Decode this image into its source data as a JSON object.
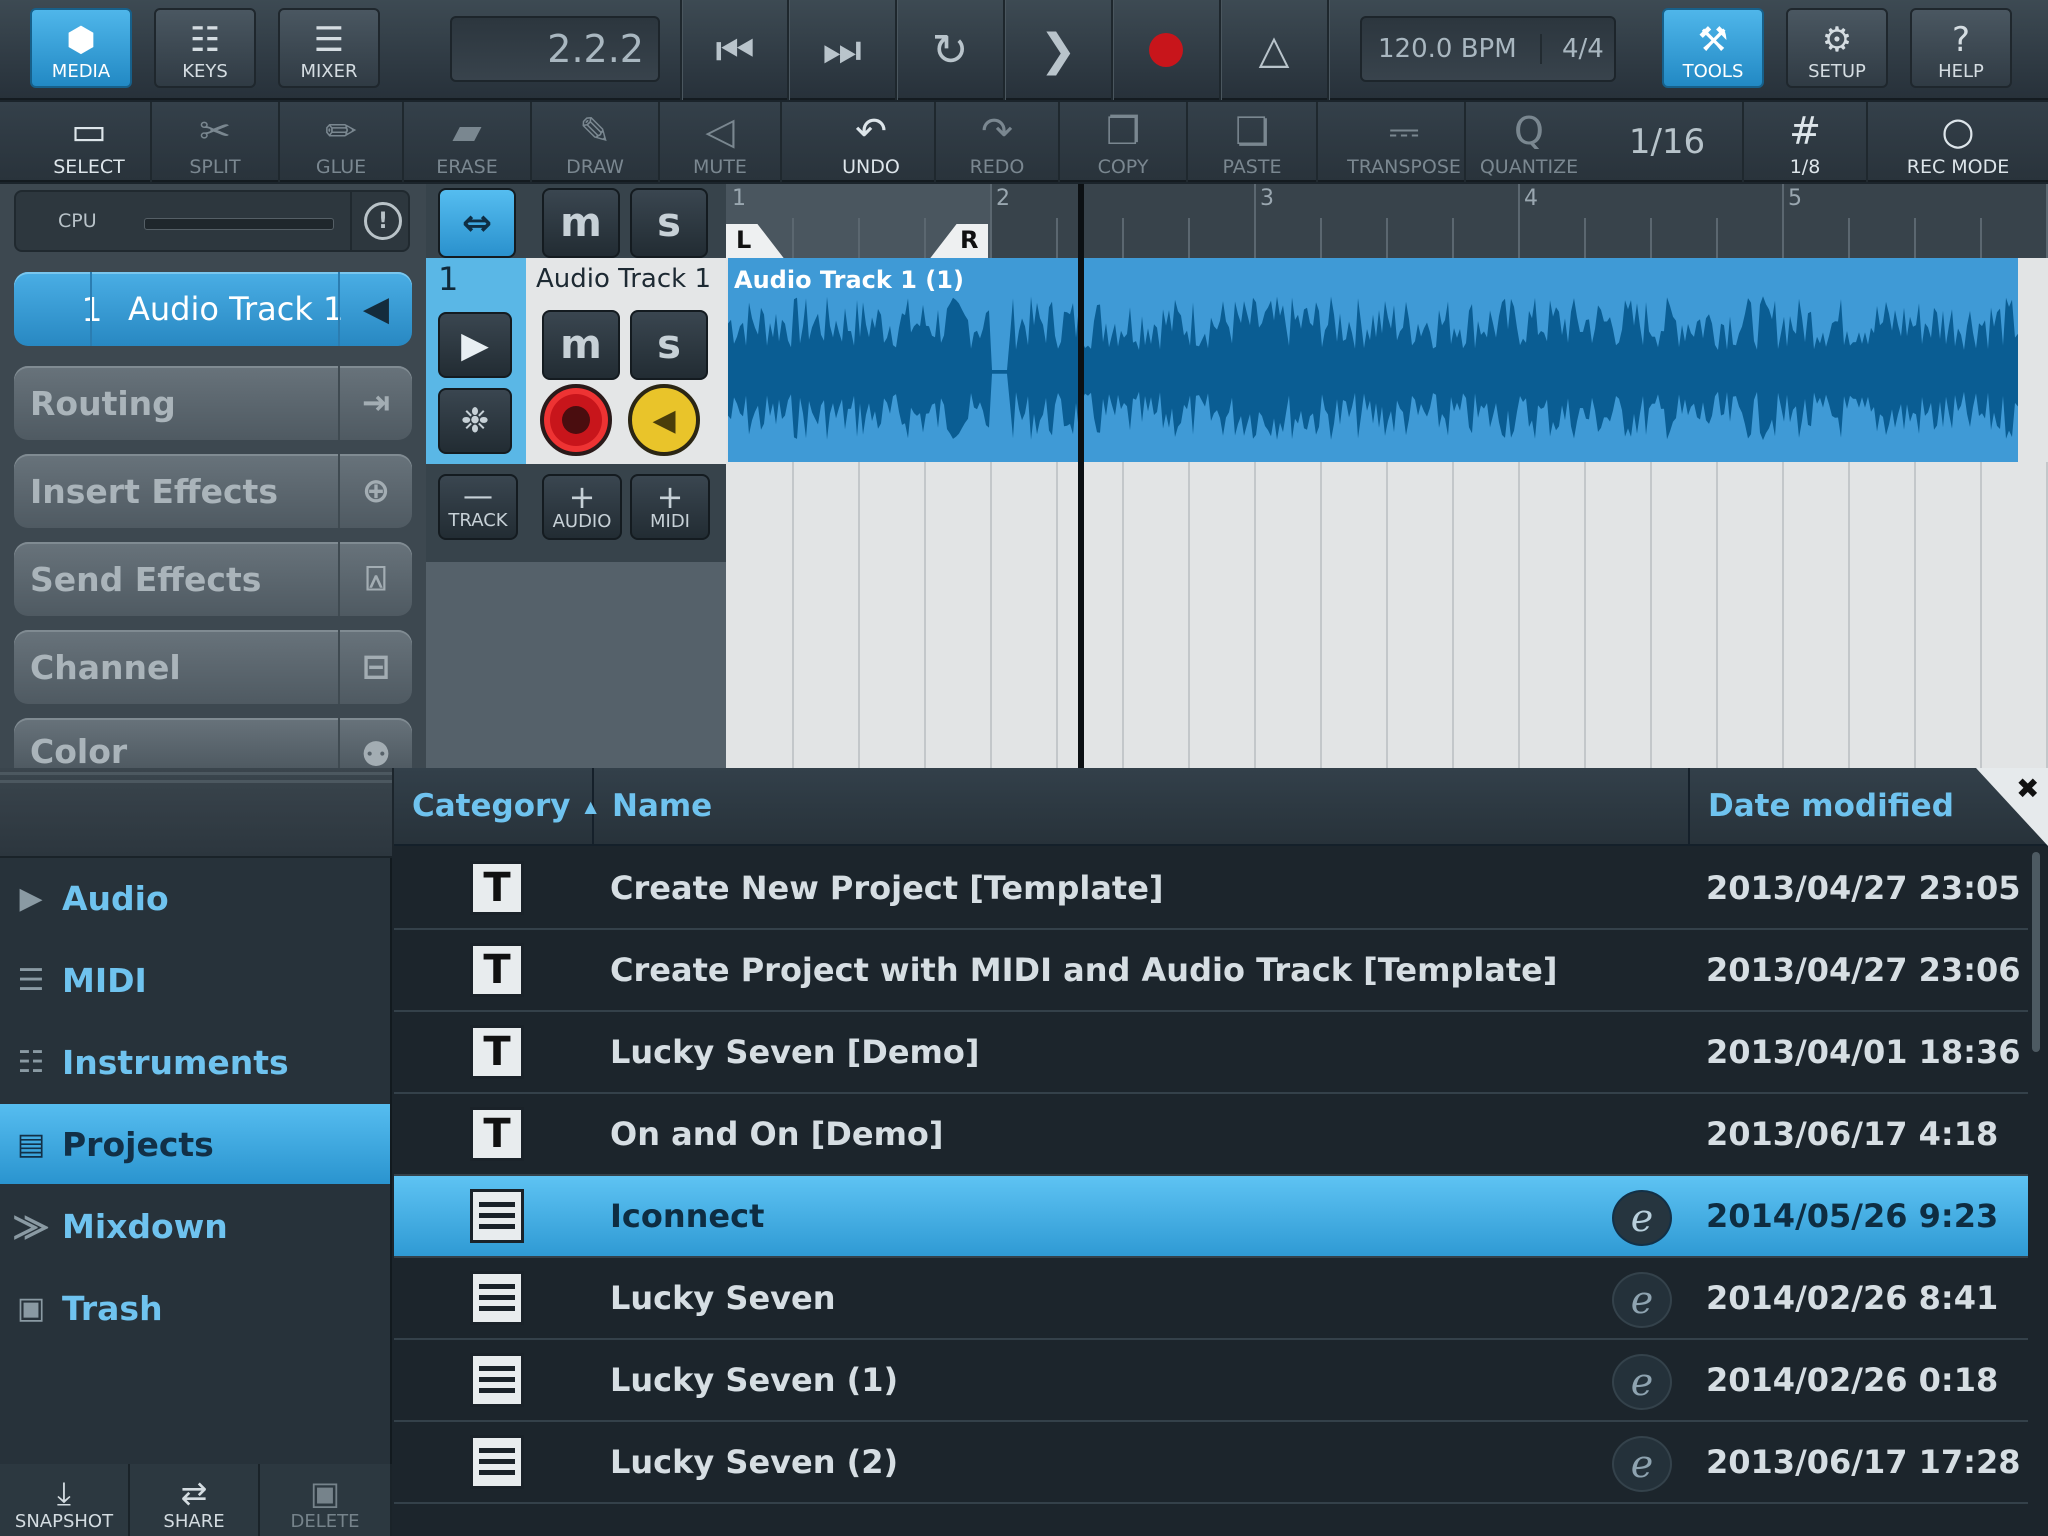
{
  "topbar": {
    "media": {
      "label": "MEDIA",
      "icon": "cube-icon"
    },
    "keys": {
      "label": "KEYS",
      "icon": "keys-icon"
    },
    "mixer": {
      "label": "MIXER",
      "icon": "mixer-icon"
    },
    "position": "2.2.2",
    "transport": [
      "skip-to-start-icon",
      "skip-to-end-icon",
      "loop-icon",
      "play-icon",
      "record-icon",
      "metronome-icon"
    ],
    "tempo": "120.0 BPM",
    "signature": "4/4",
    "tools": {
      "label": "TOOLS",
      "icon": "hammer-icon"
    },
    "setup": {
      "label": "SETUP",
      "icon": "gear-icon"
    },
    "help": {
      "label": "HELP",
      "icon": "question-icon"
    }
  },
  "toolbar": {
    "select": "SELECT",
    "split": "SPLIT",
    "glue": "GLUE",
    "erase": "ERASE",
    "draw": "DRAW",
    "mute": "MUTE",
    "undo": "UNDO",
    "redo": "REDO",
    "copy": "COPY",
    "paste": "PASTE",
    "transpose": "TRANSPOSE",
    "quantize": "QUANTIZE",
    "quantize_value": "1/16",
    "grid": "1/8",
    "rec_mode": "REC MODE"
  },
  "inspector": {
    "cpu_label": "CPU",
    "track_number": "1",
    "track_name": "Audio Track 1",
    "items": [
      "Routing",
      "Insert Effects",
      "Send Effects",
      "Channel",
      "Color"
    ]
  },
  "track": {
    "number": "1",
    "name": "Audio Track 1",
    "mute": "m",
    "solo": "s",
    "remove_track": "TRACK",
    "add_audio": "AUDIO",
    "add_midi": "MIDI"
  },
  "timeline": {
    "bars": [
      "1",
      "2",
      "3",
      "4",
      "5"
    ],
    "locator_left": "L",
    "locator_right": "R",
    "clip_name": "Audio Track 1 (1)"
  },
  "browser": {
    "columns": {
      "category": "Category",
      "name": "Name",
      "date": "Date modified"
    },
    "categories": [
      {
        "label": "Audio",
        "icon": "play-icon"
      },
      {
        "label": "MIDI",
        "icon": "midi-icon"
      },
      {
        "label": "Instruments",
        "icon": "keys-icon"
      },
      {
        "label": "Projects",
        "icon": "list-icon"
      },
      {
        "label": "Mixdown",
        "icon": "mixdown-icon"
      },
      {
        "label": "Trash",
        "icon": "trash-icon"
      }
    ],
    "selected_category": "Projects",
    "rows": [
      {
        "type": "template",
        "name": "Create New Project [Template]",
        "date": "2013/04/27 23:05"
      },
      {
        "type": "template",
        "name": "Create Project with MIDI and Audio Track [Template]",
        "date": "2013/04/27 23:06"
      },
      {
        "type": "template",
        "name": "Lucky Seven [Demo]",
        "date": "2013/04/01 18:36"
      },
      {
        "type": "template",
        "name": "On and On [Demo]",
        "date": "2013/06/17 4:18"
      },
      {
        "type": "project",
        "name": "Iconnect",
        "date": "2014/05/26 9:23",
        "selected": true
      },
      {
        "type": "project",
        "name": "Lucky Seven",
        "date": "2014/02/26 8:41"
      },
      {
        "type": "project",
        "name": "Lucky Seven (1)",
        "date": "2014/02/26 0:18"
      },
      {
        "type": "project",
        "name": "Lucky Seven (2)",
        "date": "2013/06/17 17:28"
      }
    ],
    "snapshot": "SNAPSHOT",
    "share": "SHARE",
    "delete": "DELETE",
    "close_icon": "close-icon"
  },
  "colors": {
    "accent": "#2a9bd6",
    "record": "#c8151b",
    "waveform": "#0a5d93",
    "clip": "#3f9ad6"
  }
}
